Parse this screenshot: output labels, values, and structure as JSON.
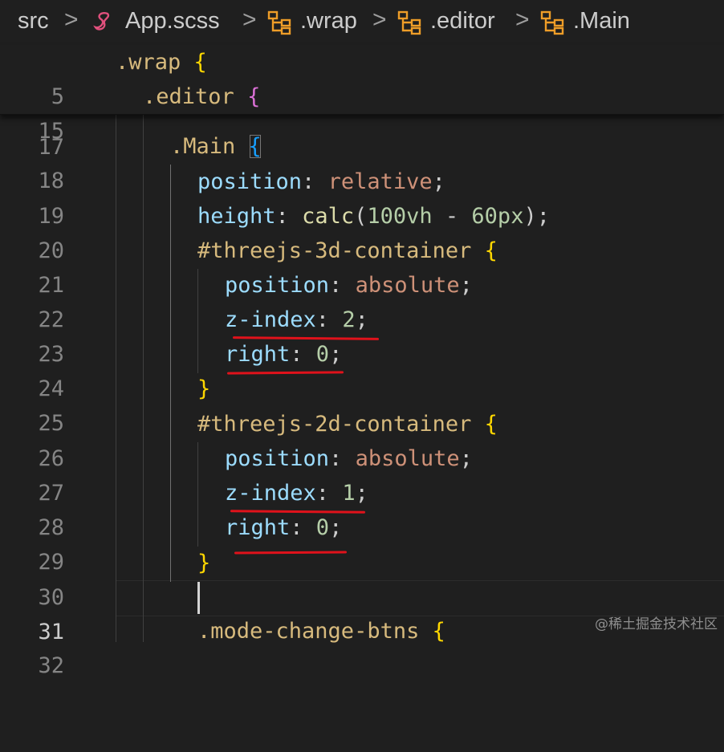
{
  "breadcrumb": {
    "items": [
      {
        "label": "src",
        "icon": "folder"
      },
      {
        "label": "App.scss",
        "icon": "sass-file-icon"
      },
      {
        "label": ".wrap",
        "icon": "symbol-class-icon"
      },
      {
        "label": ".editor",
        "icon": "symbol-class-icon"
      },
      {
        "label": ".Main",
        "icon": "symbol-class-icon"
      }
    ],
    "separator": ">"
  },
  "sticky_scroll": [
    {
      "line": "5",
      "tokens": [
        {
          "t": ".wrap",
          "c": "sel"
        },
        {
          "t": " "
        },
        {
          "t": "{",
          "c": "b1"
        }
      ]
    },
    {
      "line": "15",
      "tokens": [
        {
          "t": ".editor",
          "c": "sel"
        },
        {
          "t": " "
        },
        {
          "t": "{",
          "c": "b2"
        }
      ]
    }
  ],
  "code": [
    {
      "line": "17",
      "tokens": []
    },
    {
      "line": "18",
      "tokens": [
        {
          "t": ".Main",
          "c": "sel"
        },
        {
          "t": " "
        },
        {
          "t": "{",
          "c": "b3"
        }
      ]
    },
    {
      "line": "19",
      "tokens": [
        {
          "t": "position",
          "c": "prop"
        },
        {
          "t": ": ",
          "c": "pun"
        },
        {
          "t": "relative",
          "c": "val"
        },
        {
          "t": ";",
          "c": "pun"
        }
      ]
    },
    {
      "line": "20",
      "tokens": [
        {
          "t": "height",
          "c": "prop"
        },
        {
          "t": ": ",
          "c": "pun"
        },
        {
          "t": "calc",
          "c": "fn"
        },
        {
          "t": "(",
          "c": "pun"
        },
        {
          "t": "100vh",
          "c": "num"
        },
        {
          "t": " - ",
          "c": "pun"
        },
        {
          "t": "60px",
          "c": "num"
        },
        {
          "t": ");",
          "c": "pun"
        }
      ]
    },
    {
      "line": "21",
      "tokens": [
        {
          "t": "#threejs-3d-container",
          "c": "sel"
        },
        {
          "t": " "
        },
        {
          "t": "{",
          "c": "b1"
        }
      ]
    },
    {
      "line": "22",
      "tokens": [
        {
          "t": "position",
          "c": "prop"
        },
        {
          "t": ": ",
          "c": "pun"
        },
        {
          "t": "absolute",
          "c": "val"
        },
        {
          "t": ";",
          "c": "pun"
        }
      ]
    },
    {
      "line": "23",
      "tokens": [
        {
          "t": "z-index",
          "c": "prop"
        },
        {
          "t": ": ",
          "c": "pun"
        },
        {
          "t": "2",
          "c": "num"
        },
        {
          "t": ";",
          "c": "pun"
        }
      ]
    },
    {
      "line": "24",
      "tokens": [
        {
          "t": "right",
          "c": "prop"
        },
        {
          "t": ": ",
          "c": "pun"
        },
        {
          "t": "0",
          "c": "num"
        },
        {
          "t": ";",
          "c": "pun"
        }
      ]
    },
    {
      "line": "25",
      "tokens": [
        {
          "t": "}",
          "c": "b1"
        }
      ]
    },
    {
      "line": "26",
      "tokens": [
        {
          "t": "#threejs-2d-container",
          "c": "sel"
        },
        {
          "t": " "
        },
        {
          "t": "{",
          "c": "b1"
        }
      ]
    },
    {
      "line": "27",
      "tokens": [
        {
          "t": "position",
          "c": "prop"
        },
        {
          "t": ": ",
          "c": "pun"
        },
        {
          "t": "absolute",
          "c": "val"
        },
        {
          "t": ";",
          "c": "pun"
        }
      ]
    },
    {
      "line": "28",
      "tokens": [
        {
          "t": "z-index",
          "c": "prop"
        },
        {
          "t": ": ",
          "c": "pun"
        },
        {
          "t": "1",
          "c": "num"
        },
        {
          "t": ";",
          "c": "pun"
        }
      ]
    },
    {
      "line": "29",
      "tokens": [
        {
          "t": "right",
          "c": "prop"
        },
        {
          "t": ": ",
          "c": "pun"
        },
        {
          "t": "0",
          "c": "num"
        },
        {
          "t": ";",
          "c": "pun"
        }
      ]
    },
    {
      "line": "30",
      "tokens": [
        {
          "t": "}",
          "c": "b1"
        }
      ]
    },
    {
      "line": "31",
      "tokens": []
    },
    {
      "line": "32",
      "tokens": [
        {
          "t": ".mode-change-btns",
          "c": "sel"
        },
        {
          "t": " "
        },
        {
          "t": "{",
          "c": "b1"
        }
      ]
    }
  ],
  "active_line": "31",
  "watermark": "@稀土掘金技术社区",
  "colors": {
    "background": "#1f1f1f",
    "selector": "#d7ba7d",
    "property": "#9cdcfe",
    "string_value": "#ce9178",
    "number": "#b5cea8",
    "function": "#dcdcaa",
    "bracket_level1": "#ffd700",
    "bracket_level2": "#da70d6",
    "bracket_level3": "#179fff",
    "annotation_underline": "#e0121b"
  }
}
